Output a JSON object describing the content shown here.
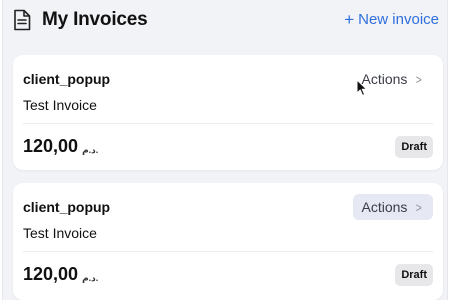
{
  "header": {
    "title": "My Invoices",
    "new_invoice_icon": "plus",
    "new_invoice_label": "New invoice"
  },
  "invoices": [
    {
      "client": "client_popup",
      "description": "Test Invoice",
      "amount": "120,00",
      "currency": "د.م.",
      "status": "Draft",
      "actions_label": "Actions"
    },
    {
      "client": "client_popup",
      "description": "Test Invoice",
      "amount": "120,00",
      "currency": "د.م.",
      "status": "Draft",
      "actions_label": "Actions"
    }
  ],
  "colors": {
    "accent": "#2f6fdb",
    "background": "#f2f3f7",
    "card": "#ffffff",
    "badge": "#e7e7ea",
    "actions_hover": "#e6e9f3"
  }
}
